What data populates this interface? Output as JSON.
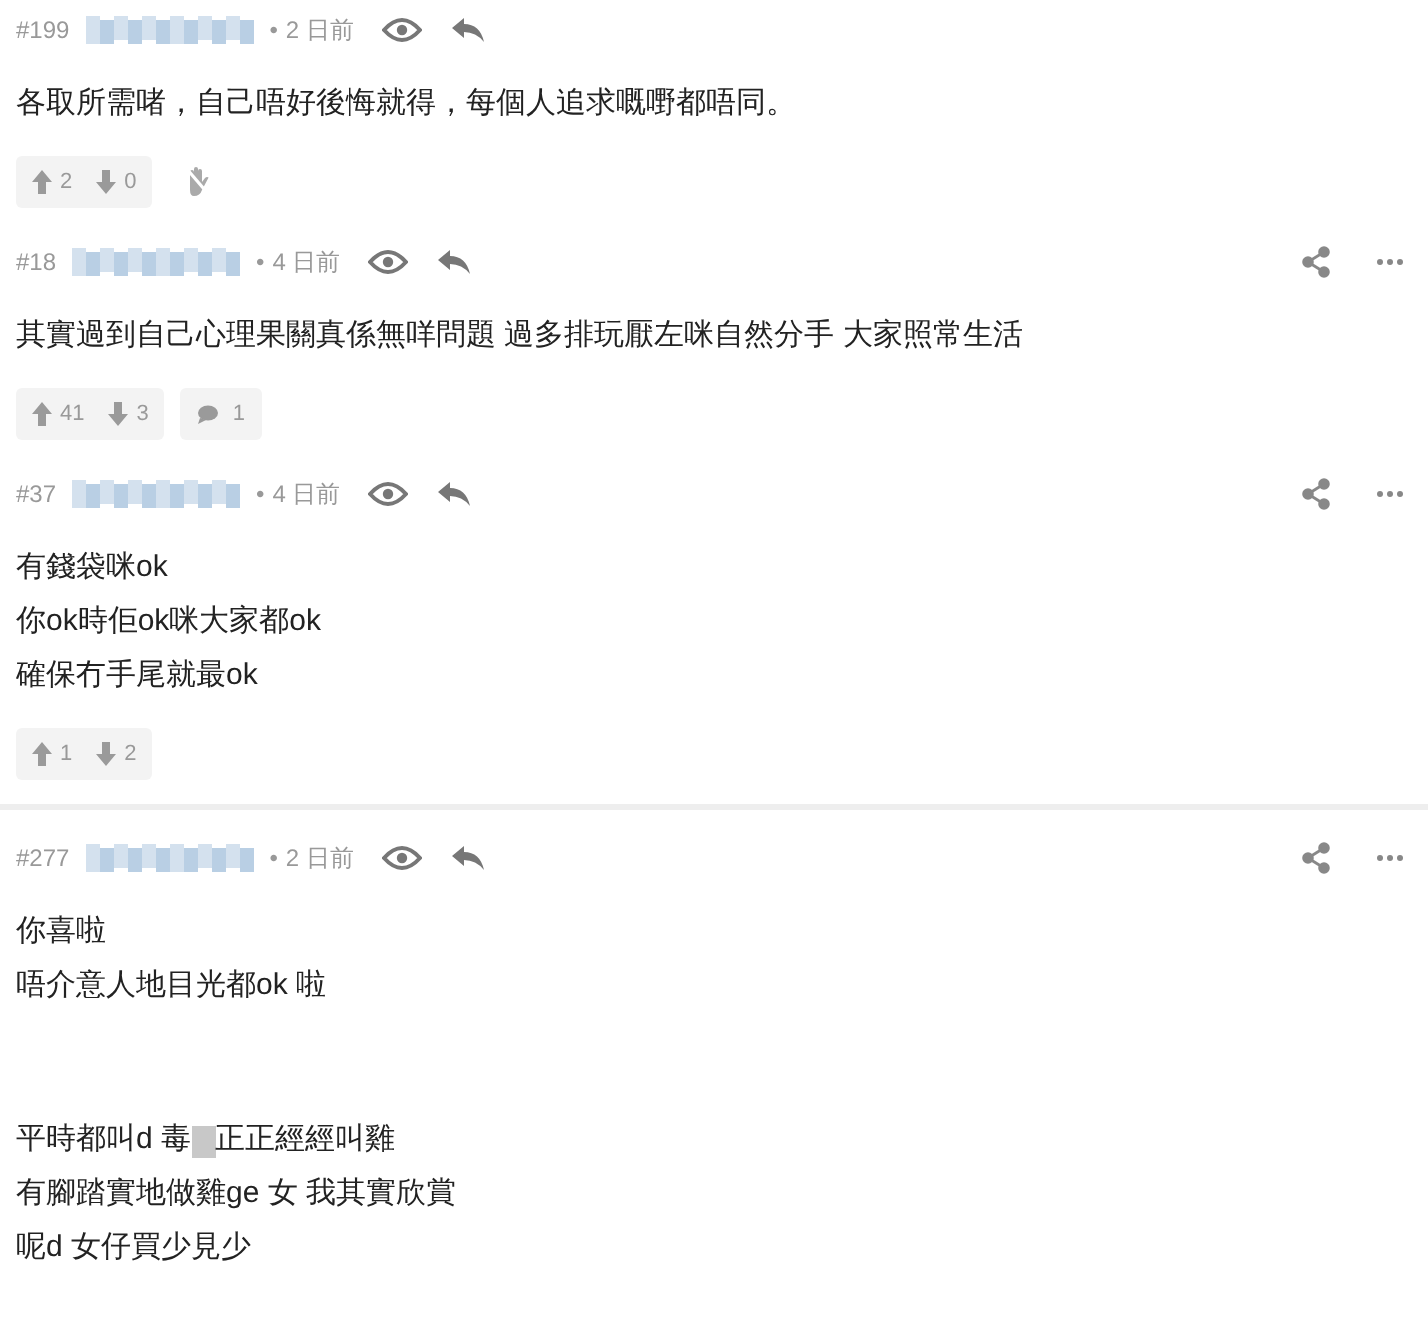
{
  "posts": [
    {
      "number": "#199",
      "separator": "•",
      "time": "2 日前",
      "actions": false,
      "divider_after": false,
      "paragraphs": [
        [
          [
            {
              "kind": "text",
              "text": "各取所需啫，自己唔好後悔就得，每個人追求嘅嘢都唔同。"
            }
          ]
        ]
      ],
      "votes": {
        "up": "2",
        "down": "0"
      },
      "hand": true
    },
    {
      "number": "#18",
      "separator": "•",
      "time": "4 日前",
      "actions": true,
      "divider_after": false,
      "paragraphs": [
        [
          [
            {
              "kind": "text",
              "text": "其實過到自己心理果關真係無咩問題 過多排玩厭左咪自然分手 大家照常生活"
            }
          ]
        ]
      ],
      "votes": {
        "up": "41",
        "down": "3"
      },
      "comments": "1",
      "hand": false
    },
    {
      "number": "#37",
      "separator": "•",
      "time": "4 日前",
      "actions": true,
      "divider_after": true,
      "paragraphs": [
        [
          [
            {
              "kind": "text",
              "text": "有錢袋咪ok"
            }
          ],
          [
            {
              "kind": "text",
              "text": "你ok時佢ok咪大家都ok"
            }
          ],
          [
            {
              "kind": "text",
              "text": "確保冇手尾就最ok"
            }
          ]
        ]
      ],
      "votes": {
        "up": "1",
        "down": "2"
      },
      "hand": false
    },
    {
      "number": "#277",
      "separator": "•",
      "time": "2 日前",
      "actions": true,
      "divider_after": false,
      "paragraphs": [
        [
          [
            {
              "kind": "text",
              "text": "你喜啦"
            }
          ],
          [
            {
              "kind": "text",
              "text": "唔介意人地目光都ok 啦"
            }
          ]
        ],
        [
          [
            {
              "kind": "text",
              "text": "平時都叫d 毒"
            },
            {
              "kind": "blur"
            },
            {
              "kind": "text",
              "text": "正正經經叫雞"
            }
          ],
          [
            {
              "kind": "text",
              "text": "有腳踏實地做雞ge 女 我其實欣賞"
            }
          ],
          [
            {
              "kind": "text",
              "text": "呢d 女仔買少見少"
            }
          ]
        ]
      ],
      "hand": false
    }
  ]
}
